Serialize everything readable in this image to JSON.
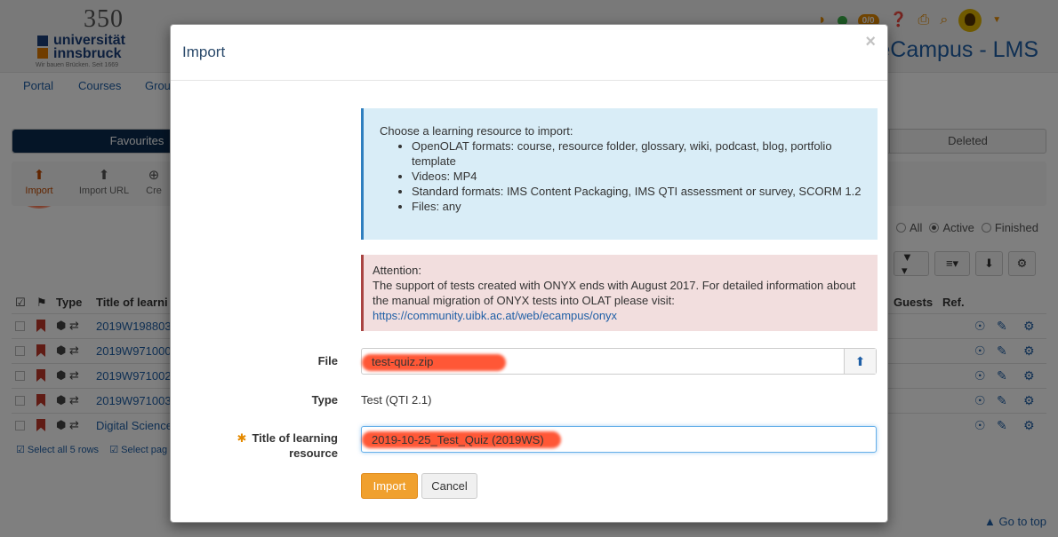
{
  "header": {
    "logo_number": "350",
    "logo_line1": "universität",
    "logo_line2": "innsbruck",
    "logo_tagline": "Wir bauen Brücken. Seit 1669",
    "brand": "eCampus - LMS",
    "notification_count": "0/0"
  },
  "nav": {
    "items": [
      "Portal",
      "Courses",
      "Grou"
    ]
  },
  "segments": {
    "favourites": "Favourites",
    "deleted": "Deleted"
  },
  "toolbar": {
    "import": "Import",
    "import_url": "Import URL",
    "create": "Cre"
  },
  "filters": {
    "all": "All",
    "active": "Active",
    "finished": "Finished",
    "selected": "active"
  },
  "table": {
    "headers": {
      "type": "Type",
      "title": "Title of learni",
      "guests": "Guests",
      "ref": "Ref."
    },
    "rows": [
      "2019W198803",
      "2019W971000",
      "2019W971002",
      "2019W971003",
      "Digital Science"
    ],
    "select_all": "Select all 5 rows",
    "select_page": "Select pag"
  },
  "goto_top": "Go to top",
  "modal": {
    "title": "Import",
    "close": "×",
    "info": {
      "intro": "Choose a learning resource to import:",
      "items": [
        "OpenOLAT formats: course, resource folder, glossary, wiki, podcast, blog, portfolio template",
        "Videos: MP4",
        "Standard formats: IMS Content Packaging, IMS QTI assessment or survey, SCORM 1.2",
        "Files: any"
      ]
    },
    "warning": {
      "heading": "Attention:",
      "text": "The support of tests created with ONYX ends with August 2017. For detailed information about the manual migration of ONYX tests into OLAT please visit:",
      "link": "https://community.uibk.ac.at/web/ecampus/onyx"
    },
    "file_label": "File",
    "file_value": "test-quiz.zip",
    "type_label": "Type",
    "type_value": "Test (QTI 2.1)",
    "title_label": "Title of learning resource",
    "title_value": "2019-10-25_Test_Quiz (2019WS)",
    "import_button": "Import",
    "cancel_button": "Cancel"
  }
}
